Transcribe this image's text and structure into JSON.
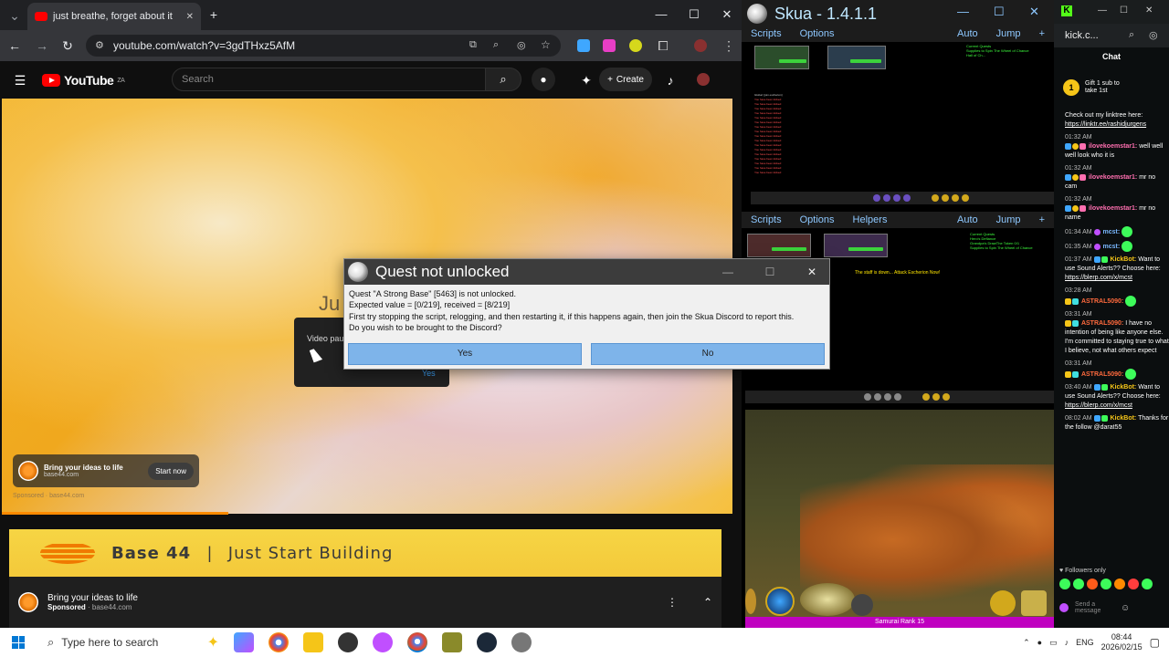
{
  "chrome": {
    "tab_title": "just breathe, forget about it",
    "url": "youtube.com/watch?v=3gdTHxz5AfM",
    "win_min": "—",
    "win_max": "☐",
    "win_close": "✕"
  },
  "youtube": {
    "logo": "YouTube",
    "country": "ZA",
    "search_placeholder": "Search",
    "create_label": "Create",
    "video_overlay_text": "Ju",
    "paused_text": "Video pau",
    "paused_yes": "Yes",
    "ad_title": "Bring your ideas to life",
    "ad_domain": "base44.com",
    "ad_cta": "Start now",
    "sponsored": "Sponsored · base44.com",
    "banner_brand": "Base 44",
    "banner_sep": "|",
    "banner_tagline": "Just Start Building",
    "adrow_title": "Bring your ideas to life",
    "adrow_sponsored": "Sponsored",
    "adrow_domain": " · base44.com"
  },
  "dialog": {
    "title": "Quest not unlocked",
    "line1": "Quest \"A Strong Base\" [5463] is not unlocked.",
    "line2": "Expected value = [0/219], received = [8/219]",
    "line3": "First try stopping the script, relogging, and then restarting it, if this happens again, then join the Skua Discord to report this.",
    "line4": "Do you wish to be brought to the Discord?",
    "yes": "Yes",
    "no": "No"
  },
  "skua": {
    "title": "Skua - 1.4.1.1",
    "menu1": [
      "Scripts",
      "Options"
    ],
    "menu1_right": [
      "Auto",
      "Jump",
      "+"
    ],
    "menu2": [
      "Scripts",
      "Options",
      "Helpers"
    ],
    "menu2_right": [
      "Auto",
      "Jump",
      "+"
    ],
    "panel2_status": "The staff is down... Attack Escherion Now!",
    "rank_label": "Samurai Rank 15"
  },
  "kick": {
    "addr": "kick.c...",
    "chat_title": "Chat",
    "gift_line1": "Gift 1 sub to",
    "gift_line2": "take 1st",
    "pin_text": "Check out my linktree here:",
    "pin_link": "https://linktr.ee/rashidjurgens",
    "messages": [
      {
        "time": "01:32 AM",
        "user": "ilovekoemstar1:",
        "text": "well well well look who it is"
      },
      {
        "time": "01:32 AM",
        "user": "ilovekoemstar1:",
        "text": "mr no cam"
      },
      {
        "time": "01:32 AM",
        "user": "ilovekoemstar1:",
        "text": "mr no name"
      },
      {
        "time": "01:34 AM",
        "user": "mcst:",
        "text": ""
      },
      {
        "time": "01:35 AM",
        "user": "mcst:",
        "text": ""
      },
      {
        "time": "01:37 AM",
        "user": "KickBot:",
        "text": "Want to use Sound Alerts?? Choose here:",
        "link": "https://blerp.com/x/mcst"
      },
      {
        "time": "03:28 AM",
        "user": "ASTRAL5090:",
        "text": ""
      },
      {
        "time": "03:31 AM",
        "user": "ASTRAL5090:",
        "text": "I have no intention of being like anyone else. I'm committed to staying true to what I believe, not what others expect"
      },
      {
        "time": "03:31 AM",
        "user": "ASTRAL5090:",
        "text": ""
      },
      {
        "time": "03:40 AM",
        "user": "KickBot:",
        "text": "Want to use Sound Alerts?? Choose here:",
        "link": "https://blerp.com/x/mcst"
      },
      {
        "time": "08:02 AM",
        "user": "KickBot:",
        "text": "Thanks for the follow @darat55"
      }
    ],
    "followers_only": "Followers only",
    "send_placeholder": "Send a message"
  },
  "taskbar": {
    "search_placeholder": "Type here to search",
    "lang": "ENG",
    "time": "08:44",
    "date": "2026/02/15"
  },
  "colors": {
    "accent_blue": "#7eb4ea",
    "youtube_red": "#ff0000",
    "kick_green": "#53fc18"
  }
}
